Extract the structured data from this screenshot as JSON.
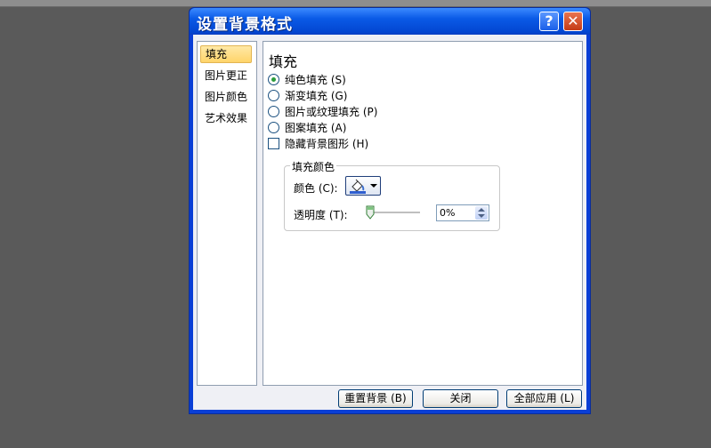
{
  "dialog": {
    "title": "设置背景格式",
    "help_label": "?",
    "close_label": "✕"
  },
  "nav": {
    "items": [
      {
        "label": "填充",
        "selected": true
      },
      {
        "label": "图片更正",
        "selected": false
      },
      {
        "label": "图片颜色",
        "selected": false
      },
      {
        "label": "艺术效果",
        "selected": false
      }
    ]
  },
  "fill": {
    "section_title": "填充",
    "options": [
      {
        "label": "纯色填充 (S)",
        "checked": true
      },
      {
        "label": "渐变填充 (G)",
        "checked": false
      },
      {
        "label": "图片或纹理填充 (P)",
        "checked": false
      },
      {
        "label": "图案填充 (A)",
        "checked": false
      }
    ],
    "hide_bg_graphics": {
      "label": "隐藏背景图形 (H)",
      "checked": false
    },
    "fill_color": {
      "legend": "填充颜色",
      "color_label": "颜色 (C):",
      "transparency_label": "透明度 (T):",
      "transparency_value": "0%"
    }
  },
  "buttons": {
    "reset": "重置背景 (B)",
    "close": "关闭",
    "apply_all": "全部应用 (L)"
  }
}
